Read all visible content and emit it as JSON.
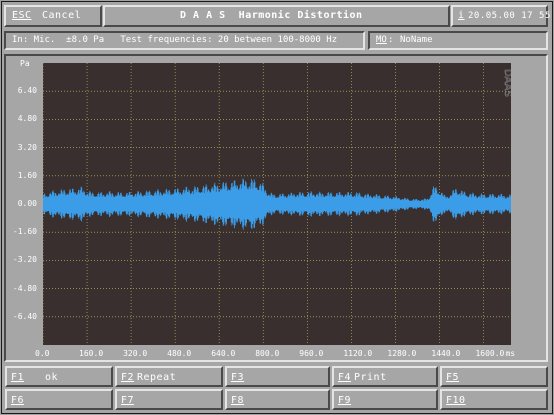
{
  "header": {
    "esc_key": "ESC",
    "esc_label": "Cancel",
    "title": "D A A S  Harmonic Distortion",
    "info_key": "i",
    "datetime": "20.05.00 17 55"
  },
  "info_bar": {
    "settings": "In: Mic.  ±8.0 Pa   Test frequencies: 20 between 100-8000 Hz",
    "mo_key": "MO",
    "mo_suffix": ":",
    "mo_value": "NoName"
  },
  "plot": {
    "y_unit": "Pa",
    "watermark": "DAAS",
    "x_unit": "ms",
    "colors": {
      "background": "#3a2f2f",
      "signal": "#3b9de8",
      "grid": "#c8c860"
    }
  },
  "chart_data": {
    "type": "line",
    "xlabel": "ms",
    "ylabel": "Pa",
    "xlim": [
      0,
      1700
    ],
    "ylim": [
      -8,
      8
    ],
    "x_ticks": [
      "0.0",
      "160.0",
      "320.0",
      "480.0",
      "640.0",
      "800.0",
      "960.0",
      "1120.0",
      "1280.0",
      "1440.0",
      "1600.0"
    ],
    "y_ticks": [
      "6.40",
      "4.80",
      "3.20",
      "1.60",
      "0.00",
      "-1.60",
      "-3.20",
      "-4.80",
      "-6.40"
    ],
    "series": [
      {
        "x": [
          0,
          20,
          40,
          60,
          80,
          100,
          120,
          140,
          160,
          180,
          200,
          220,
          240,
          260,
          280,
          300,
          320,
          340,
          360,
          380,
          400,
          420,
          440,
          460,
          480,
          500,
          520,
          540,
          560,
          580,
          600,
          620,
          640,
          660,
          680,
          700,
          720,
          740,
          760,
          780,
          800,
          820,
          840,
          860,
          880,
          900,
          920,
          940,
          960,
          980,
          1000,
          1020,
          1040,
          1060,
          1080,
          1100,
          1120,
          1140,
          1160,
          1180,
          1200,
          1220,
          1240,
          1260,
          1280,
          1300,
          1320,
          1340,
          1360,
          1380,
          1400,
          1420,
          1440,
          1460,
          1480,
          1500,
          1520,
          1540,
          1560,
          1580,
          1600,
          1620,
          1640,
          1660,
          1680
        ],
        "envelope": [
          0.6,
          0.7,
          0.8,
          0.8,
          0.9,
          0.9,
          0.95,
          1.0,
          0.8,
          0.7,
          0.7,
          0.7,
          0.75,
          0.7,
          0.7,
          0.7,
          0.7,
          0.75,
          0.75,
          0.8,
          0.8,
          0.85,
          0.85,
          0.9,
          0.9,
          0.95,
          1.0,
          1.0,
          1.05,
          1.1,
          1.15,
          1.2,
          1.25,
          1.3,
          1.35,
          1.4,
          1.45,
          1.5,
          1.5,
          1.4,
          1.2,
          0.7,
          0.6,
          0.6,
          0.65,
          0.65,
          0.7,
          0.7,
          0.7,
          0.75,
          0.7,
          0.7,
          0.7,
          0.7,
          0.7,
          0.7,
          0.7,
          0.7,
          0.65,
          0.6,
          0.6,
          0.55,
          0.5,
          0.5,
          0.45,
          0.4,
          0.35,
          0.3,
          0.3,
          0.3,
          0.35,
          1.1,
          0.9,
          0.5,
          0.6,
          1.0,
          0.8,
          0.7,
          0.65,
          0.6,
          0.6,
          0.6,
          0.6,
          0.6,
          0.55
        ]
      }
    ]
  },
  "fkeys": [
    {
      "key": "F1",
      "label": "ok"
    },
    {
      "key": "F2",
      "label": "Repeat"
    },
    {
      "key": "F3",
      "label": ""
    },
    {
      "key": "F4",
      "label": "Print"
    },
    {
      "key": "F5",
      "label": ""
    },
    {
      "key": "F6",
      "label": ""
    },
    {
      "key": "F7",
      "label": ""
    },
    {
      "key": "F8",
      "label": ""
    },
    {
      "key": "F9",
      "label": ""
    },
    {
      "key": "F10",
      "label": ""
    }
  ]
}
